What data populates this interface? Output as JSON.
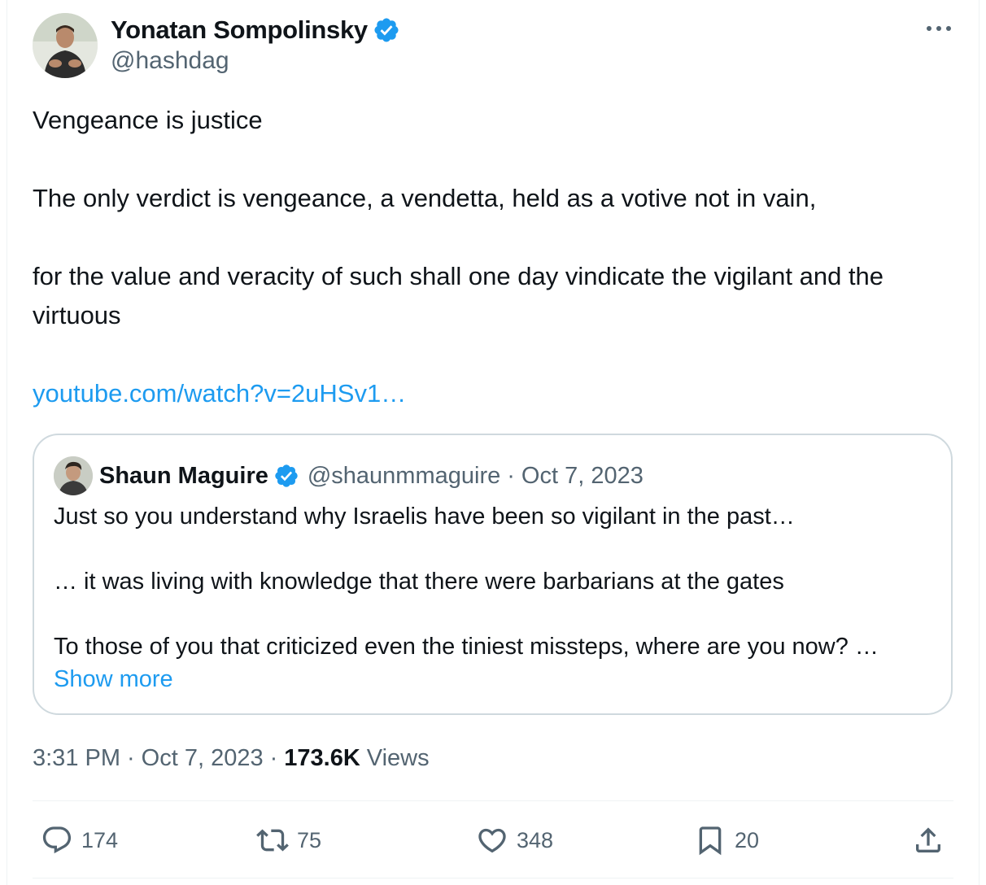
{
  "author": {
    "name": "Yonatan Sompolinsky",
    "handle": "@hashdag",
    "verified": true
  },
  "tweet": {
    "lines": [
      "Vengeance is justice",
      "The only verdict is vengeance, a vendetta, held as a votive not in vain,",
      "for the value and veracity of such shall one day vindicate the vigilant and the virtuous"
    ],
    "link": "youtube.com/watch?v=2uHSv1…"
  },
  "quoted_tweet": {
    "author_name": "Shaun Maguire",
    "handle": "@shaunmmaguire",
    "separator": "·",
    "date": "Oct 7, 2023",
    "verified": true,
    "lines": [
      "Just so you understand why Israelis have been so vigilant in the past…",
      "… it was living with knowledge that there were barbarians at the gates",
      "To those of you that criticized even the tiniest missteps, where are you now? …"
    ],
    "show_more": "Show more"
  },
  "meta": {
    "time": "3:31 PM",
    "separator": "·",
    "date": "Oct 7, 2023",
    "views_count": "173.6K",
    "views_label": "Views"
  },
  "actions": {
    "replies": "174",
    "reposts": "75",
    "likes": "348",
    "bookmarks": "20"
  },
  "colors": {
    "accent": "#1d9bf0",
    "text": "#0f1419",
    "secondary": "#536471",
    "border": "#cfd9de"
  },
  "icons": [
    "verified-badge-icon",
    "more-options-icon",
    "reply-icon",
    "repost-icon",
    "like-icon",
    "bookmark-icon",
    "share-icon"
  ]
}
